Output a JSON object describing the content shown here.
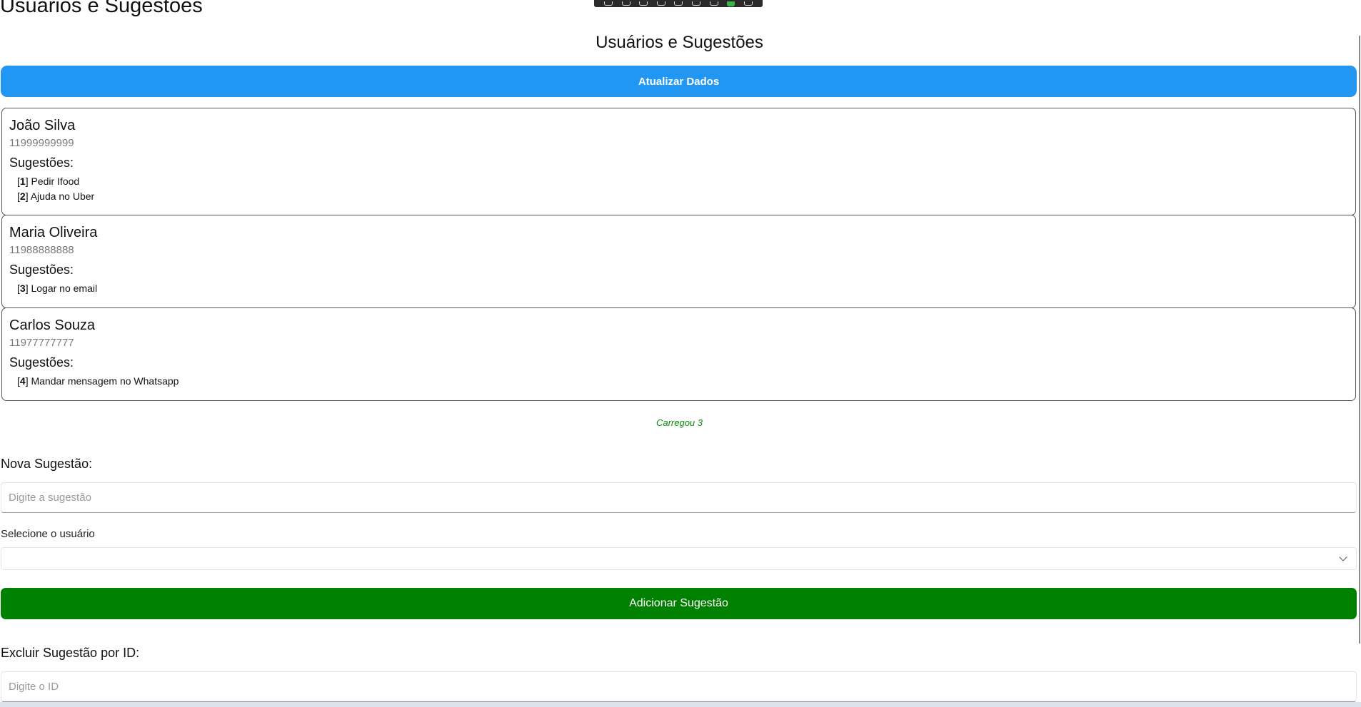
{
  "window": {
    "title": "Usuários e Sugestões"
  },
  "heading": "Usuários e Sugestões",
  "refresh_button": "Atualizar Dados",
  "suggestions_label": "Sugestões:",
  "users": [
    {
      "name": "João Silva",
      "phone": "11999999999",
      "suggestions": [
        {
          "id": "1",
          "text": "Pedir Ifood"
        },
        {
          "id": "2",
          "text": "Ajuda no Uber"
        }
      ]
    },
    {
      "name": "Maria Oliveira",
      "phone": "11988888888",
      "suggestions": [
        {
          "id": "3",
          "text": "Logar no email"
        }
      ]
    },
    {
      "name": "Carlos Souza",
      "phone": "11977777777",
      "suggestions": [
        {
          "id": "4",
          "text": "Mandar mensagem no Whatsapp"
        }
      ]
    }
  ],
  "status": "Carregou 3",
  "new_suggestion": {
    "label": "Nova Sugestão:",
    "placeholder": "Digite a sugestão",
    "value": "",
    "user_select_label": "Selecione o usuário",
    "user_select_value": "",
    "submit_label": "Adicionar Sugestão"
  },
  "delete_suggestion": {
    "label": "Excluir Sugestão por ID:",
    "placeholder": "Digite o ID",
    "value": ""
  },
  "colors": {
    "refresh_button": "#2196f3",
    "add_button": "#008000",
    "status_text": "#0a8a0a"
  }
}
